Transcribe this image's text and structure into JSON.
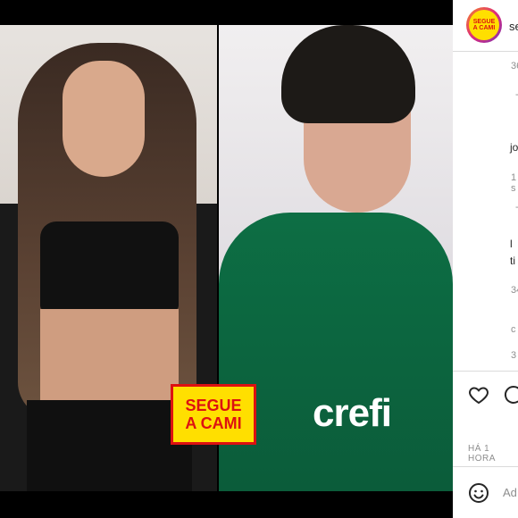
{
  "post": {
    "badge_line1": "SEGUE",
    "badge_line2": "A CAMI",
    "jersey_text": "crefi"
  },
  "sidebar": {
    "avatar_line1": "SEGUE",
    "avatar_line2": "A CAMI",
    "username": "se",
    "comments": [
      {
        "meta": "36",
        "dash": "-"
      },
      {
        "text": "jo",
        "meta": "1 s",
        "dash": "-"
      },
      {
        "text": "l",
        "text2": "ti",
        "meta": "34"
      },
      {
        "meta": "c",
        "meta2": "3"
      }
    ],
    "time_label": "HÁ 1 HORA",
    "add_comment_placeholder": "Ad"
  }
}
